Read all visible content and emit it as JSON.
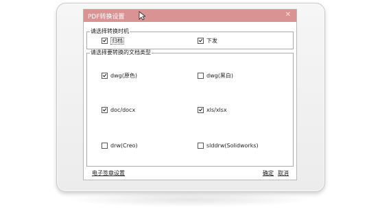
{
  "window": {
    "title": "PDF转换设置",
    "close_glyph": "✕"
  },
  "timing_group": {
    "label": "请选择转换时机",
    "options": [
      {
        "label": "归档",
        "checked": true
      },
      {
        "label": "下发",
        "checked": true
      }
    ]
  },
  "doc_type_group": {
    "label": "请选择要转换的文档类型",
    "options": [
      {
        "label": "dwg(原色)",
        "checked": true
      },
      {
        "label": "dwg(黑白)",
        "checked": false
      },
      {
        "label": "doc/docx",
        "checked": true
      },
      {
        "label": "xls/xlsx",
        "checked": true
      },
      {
        "label": "drw(Creo)",
        "checked": false
      },
      {
        "label": "slddrw(Solidworks)",
        "checked": false
      }
    ]
  },
  "footer": {
    "signature_link": "电子签章设置",
    "ok_label": "确定",
    "cancel_label": "取消"
  },
  "colors": {
    "titlebar": "#d99393",
    "frame": "#ececec"
  },
  "icons": {
    "close": "close-icon",
    "checkbox_checked": "checkbox-checked-icon",
    "checkbox_unchecked": "checkbox-unchecked-icon",
    "cursor": "mouse-cursor-icon"
  }
}
